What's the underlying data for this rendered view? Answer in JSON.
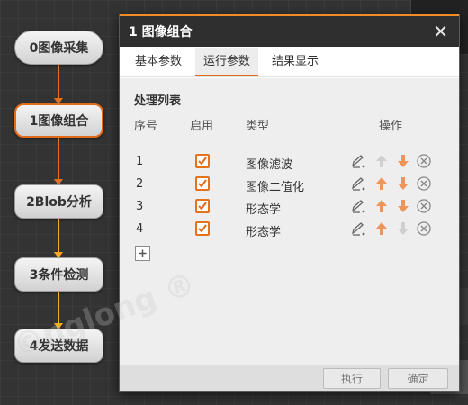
{
  "flow": {
    "nodes": [
      {
        "label": "0图像采集"
      },
      {
        "label": "1图像组合"
      },
      {
        "label": "2Blob分析"
      },
      {
        "label": "3条件检测"
      },
      {
        "label": "4发送数据"
      }
    ]
  },
  "dialog": {
    "title": "1 图像组合",
    "close_symbol": "✕",
    "tabs": [
      {
        "label": "基本参数",
        "active": false
      },
      {
        "label": "运行参数",
        "active": true
      },
      {
        "label": "结果显示",
        "active": false
      }
    ],
    "list_title": "处理列表",
    "columns": {
      "index": "序号",
      "enable": "启用",
      "type": "类型",
      "operation": "操作"
    },
    "rows": [
      {
        "index": "1",
        "enabled": true,
        "type": "图像滤波",
        "up_enabled": false,
        "down_enabled": true
      },
      {
        "index": "2",
        "enabled": true,
        "type": "图像二值化",
        "up_enabled": true,
        "down_enabled": true
      },
      {
        "index": "3",
        "enabled": true,
        "type": "形态学",
        "up_enabled": true,
        "down_enabled": true
      },
      {
        "index": "4",
        "enabled": true,
        "type": "形态学",
        "up_enabled": true,
        "down_enabled": false
      }
    ],
    "buttons": {
      "execute": "执行",
      "confirm": "确定"
    },
    "icons": {
      "edit": "edit-icon",
      "up": "arrow-up-icon",
      "down": "arrow-down-icon",
      "delete": "delete-icon",
      "add": "plus-icon",
      "check": "checkmark-icon"
    }
  },
  "colors": {
    "accent": "#e06b1a",
    "connector_orange": "#e3711f",
    "connector_yellow": "#efab2a",
    "arrow_enabled": "#f0955a",
    "arrow_disabled": "#d0d0d0"
  },
  "watermark": "©nglong ®"
}
